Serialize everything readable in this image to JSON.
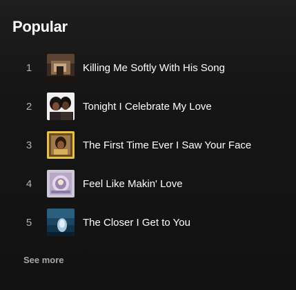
{
  "section": {
    "title": "Popular"
  },
  "tracks": [
    {
      "number": "1",
      "title": "Killing Me Softly With His Song",
      "cover_icon": "album-cover-killing-me-softly"
    },
    {
      "number": "2",
      "title": "Tonight I Celebrate My Love",
      "cover_icon": "album-cover-tonight-i-celebrate-my-love"
    },
    {
      "number": "3",
      "title": "The First Time Ever I Saw Your Face",
      "cover_icon": "album-cover-first-time-ever"
    },
    {
      "number": "4",
      "title": "Feel Like Makin' Love",
      "cover_icon": "album-cover-feel-like-makin-love"
    },
    {
      "number": "5",
      "title": "The Closer I Get to You",
      "cover_icon": "album-cover-the-closer-i-get-to-you"
    }
  ],
  "see_more": {
    "label": "See more"
  },
  "colors": {
    "background": "#121212",
    "text_primary": "#ffffff",
    "text_secondary": "#b3b3b3"
  }
}
